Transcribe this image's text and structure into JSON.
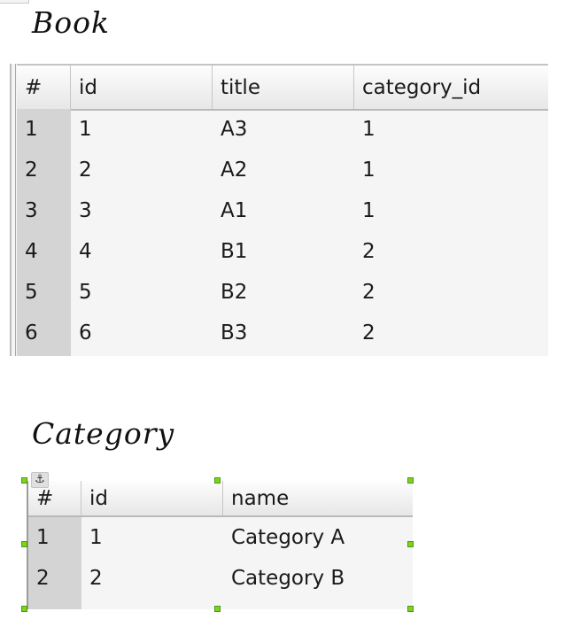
{
  "book": {
    "heading": "Book",
    "columns": [
      "#",
      "id",
      "title",
      "category_id"
    ],
    "rows": [
      [
        "1",
        "1",
        "A3",
        "1"
      ],
      [
        "2",
        "2",
        "A2",
        "1"
      ],
      [
        "3",
        "3",
        "A1",
        "1"
      ],
      [
        "4",
        "4",
        "B1",
        "2"
      ],
      [
        "5",
        "5",
        "B2",
        "2"
      ],
      [
        "6",
        "6",
        "B3",
        "2"
      ]
    ]
  },
  "category": {
    "heading": "Category",
    "columns": [
      "#",
      "id",
      "name"
    ],
    "rows": [
      [
        "1",
        "1",
        "Category A"
      ],
      [
        "2",
        "2",
        "Category B"
      ]
    ],
    "anchor_icon": "anchor-icon",
    "anchor_glyph": "⚓"
  },
  "colors": {
    "selection_handle": "#7ed321",
    "row_number_strip": "#d4d4d4",
    "table_background": "#f5f5f5"
  }
}
